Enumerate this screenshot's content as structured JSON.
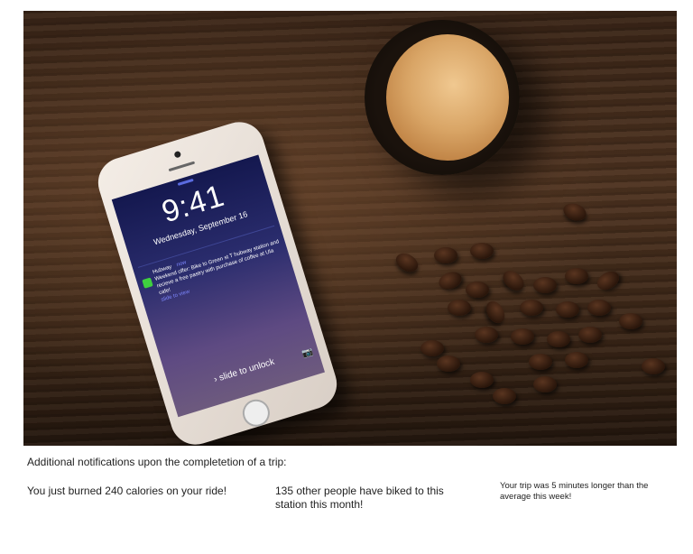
{
  "phone": {
    "time": "9:41",
    "date": "Wednesday, September 16",
    "notification": {
      "app": "Hubway",
      "when": "now",
      "message": "Weekend offer: Bike to Green st T hubway station and recieve a free pastry with purchase of coffee at Ula cafe!",
      "action": "slide to view"
    },
    "unlock_label": "› slide to unlock",
    "camera_icon": "camera-icon",
    "app_icon_color": "#3fcf3f"
  },
  "caption": "Additional notifications upon the completetion of a trip:",
  "notifications": [
    "You just burned 240 calories on your ride!",
    "135 other people have biked to this station this month!",
    "Your trip was 5 minutes longer than the average this week!"
  ]
}
